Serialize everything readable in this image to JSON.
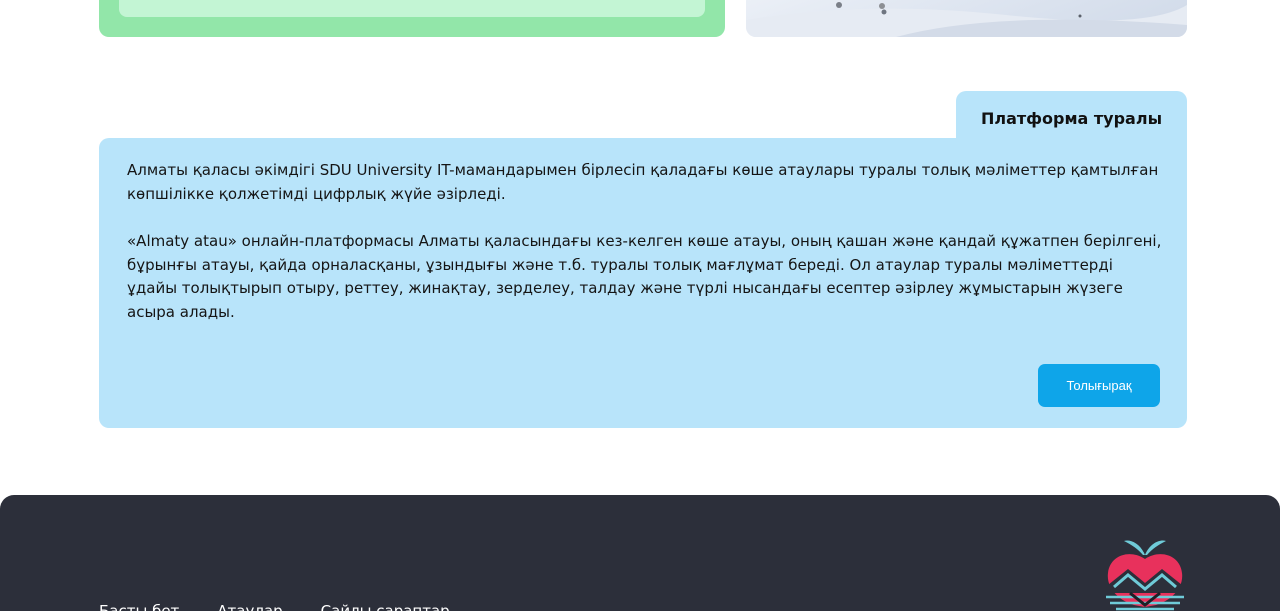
{
  "about": {
    "tab_title": "Платформа туралы",
    "paragraph_1": "Алматы қаласы әкімдігі SDU University IT-мамандарымен бірлесіп қаладағы көше атаулары туралы толық мәліметтер қамтылған көпшілікке қолжетімді цифрлық жүйе әзірледі.",
    "paragraph_2": "«Almaty atau» онлайн-платформасы Алматы қаласындағы кез-келген көше атауы, оның қашан және қандай құжатпен берілгені, бұрынғы атауы, қайда орналасқаны, ұзындығы және т.б. туралы толық мағлұмат береді. Ол атаулар туралы мәліметтерді ұдайы толықтырып отыру, реттеу, жинақтау, зерделеу, талдау және түрлі нысандағы есептер әзірлеу жұмыстарын жүзеге асыра алады.",
    "more_button": "Толығырақ"
  },
  "footer": {
    "nav": [
      "Басты бет",
      "Атаулар",
      "Сайлы сараптар"
    ],
    "logo_icon": "almaty-apple-mountain-logo"
  },
  "colors": {
    "green_card": "#92e6a9",
    "info_box": "#b8e4fa",
    "button": "#0ea5e9",
    "footer": "#2c2f3a"
  }
}
